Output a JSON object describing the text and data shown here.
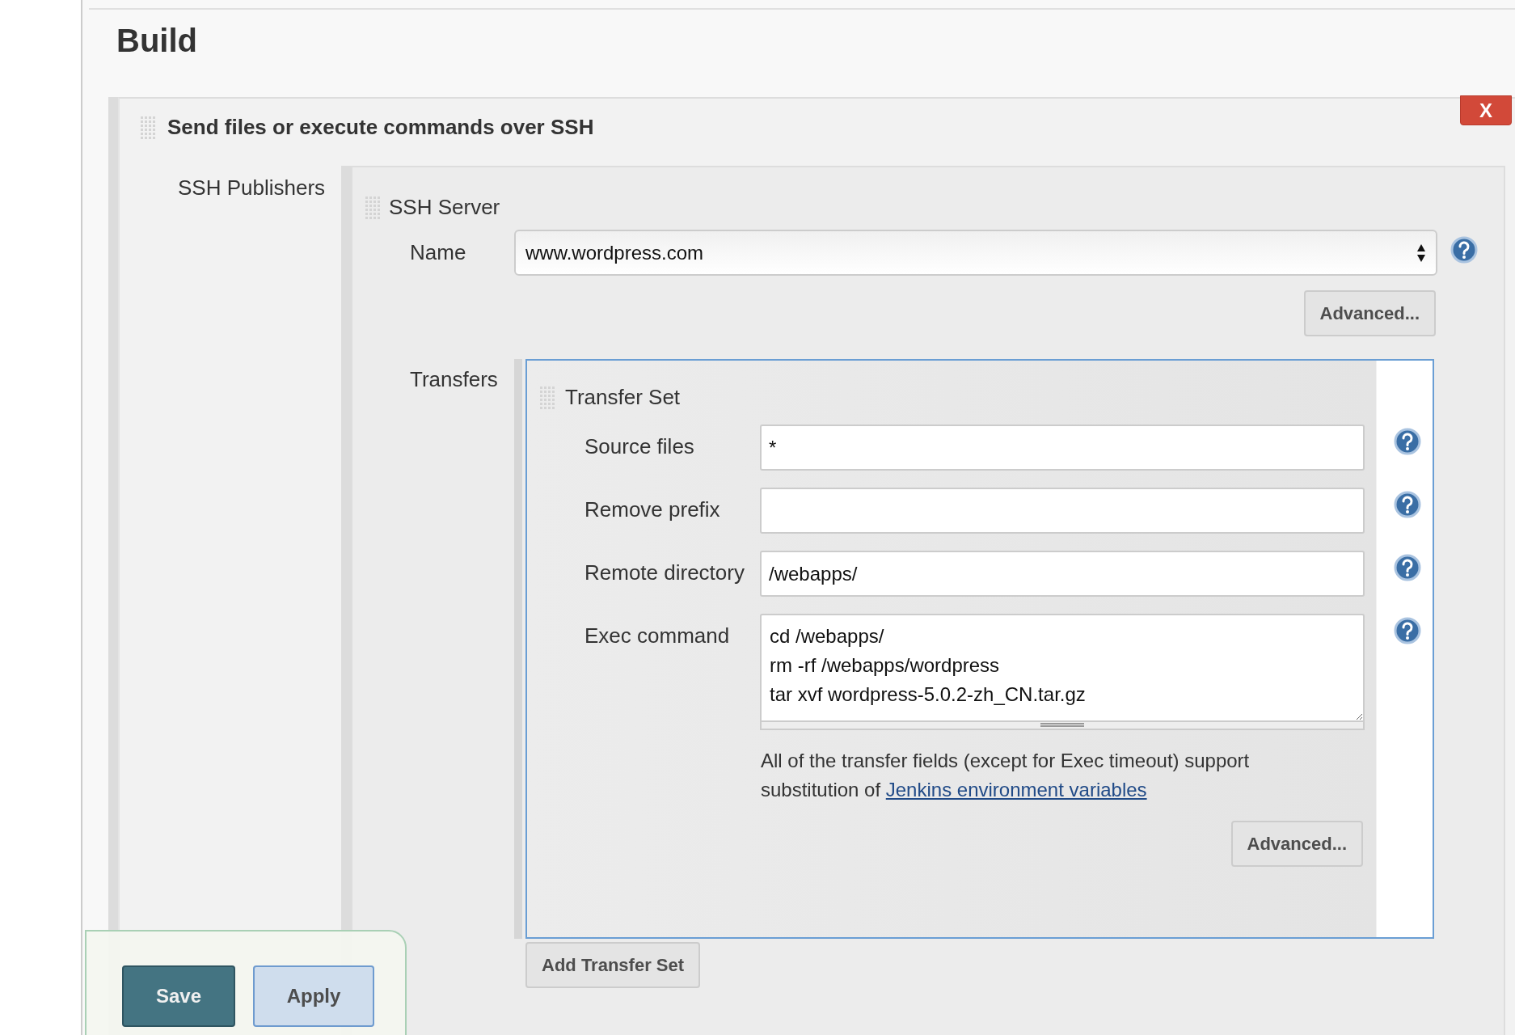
{
  "page": {
    "title": "Build"
  },
  "publisher": {
    "title": "Send files or execute commands over SSH",
    "remove_button": "X",
    "label": "SSH Publishers",
    "server": {
      "title": "SSH Server",
      "name_label": "Name",
      "name_value": "www.wordpress.com",
      "advanced_button": "Advanced...",
      "transfers_label": "Transfers",
      "transfer_set": {
        "title": "Transfer Set",
        "fields": [
          {
            "kind": "input",
            "label": "Source files",
            "value": "*"
          },
          {
            "kind": "input",
            "label": "Remove prefix"
          },
          {
            "kind": "input",
            "label": "Remote directory",
            "value": "/webapps/"
          },
          {
            "kind": "textarea",
            "label": "Exec command",
            "value": "cd /webapps/\nrm -rf /webapps/wordpress\ntar xvf wordpress-5.0.2-zh_CN.tar.gz"
          }
        ],
        "note": "All of the transfer fields (except for Exec timeout) support substitution of",
        "note_link": "Jenkins environment variables",
        "advanced_button": "Advanced..."
      },
      "add_button": "Add Transfer Set"
    }
  },
  "actions": [
    {
      "kind": "primary",
      "label": "Save"
    },
    {
      "kind": "secondary",
      "label": "Apply"
    }
  ]
}
